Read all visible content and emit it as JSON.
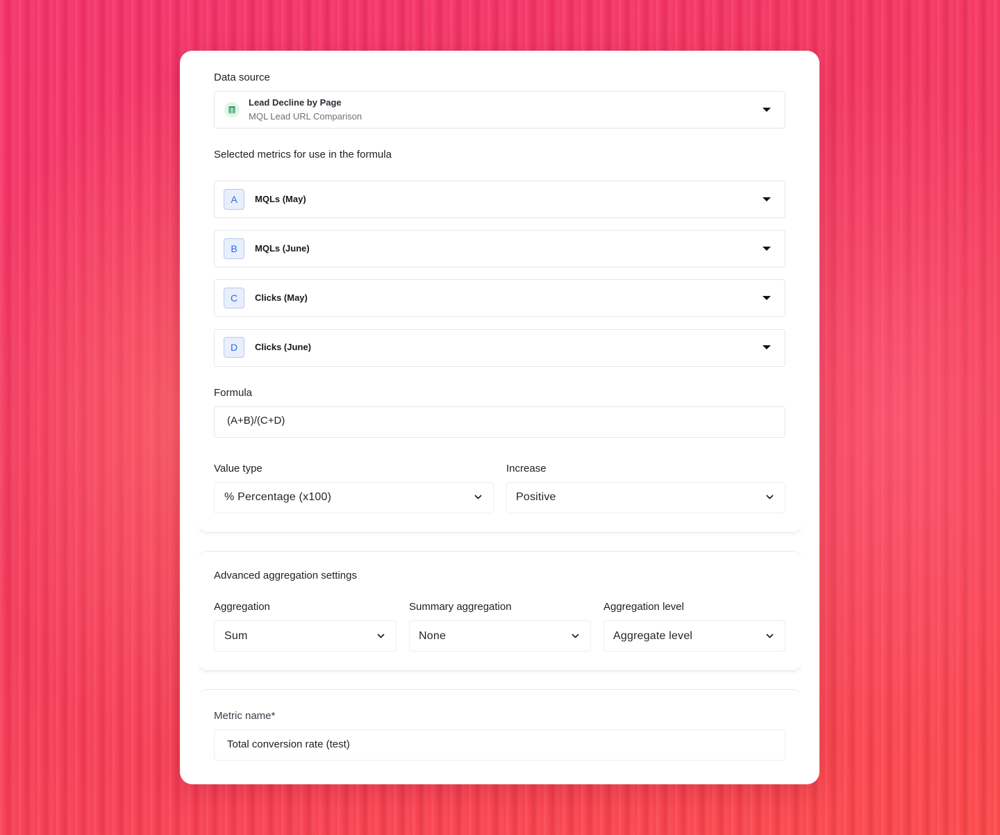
{
  "data_source": {
    "label": "Data source",
    "title": "Lead Decline by Page",
    "subtitle": "MQL Lead URL Comparison",
    "icon": "google-sheets-icon"
  },
  "metrics_section": {
    "label": "Selected metrics for use in the formula",
    "items": [
      {
        "letter": "A",
        "name": "MQLs (May)"
      },
      {
        "letter": "B",
        "name": "MQLs (June)"
      },
      {
        "letter": "C",
        "name": "Clicks (May)"
      },
      {
        "letter": "D",
        "name": "Clicks (June)"
      }
    ]
  },
  "formula": {
    "label": "Formula",
    "value": "(A+B)/(C+D)"
  },
  "value_type": {
    "label": "Value type",
    "selected": "% Percentage (x100)"
  },
  "increase": {
    "label": "Increase",
    "selected": "Positive"
  },
  "advanced": {
    "heading": "Advanced aggregation settings",
    "aggregation": {
      "label": "Aggregation",
      "selected": "Sum"
    },
    "summary_aggregation": {
      "label": "Summary aggregation",
      "selected": "None"
    },
    "aggregation_level": {
      "label": "Aggregation level",
      "selected": "Aggregate level"
    }
  },
  "metric_name": {
    "label": "Metric name*",
    "value": "Total conversion rate (test)"
  },
  "colors": {
    "badge_text": "#2f6ad9",
    "badge_bg": "#e8effc",
    "sheets_green": "#1f9d55",
    "background_pink": "#f43a5e"
  }
}
